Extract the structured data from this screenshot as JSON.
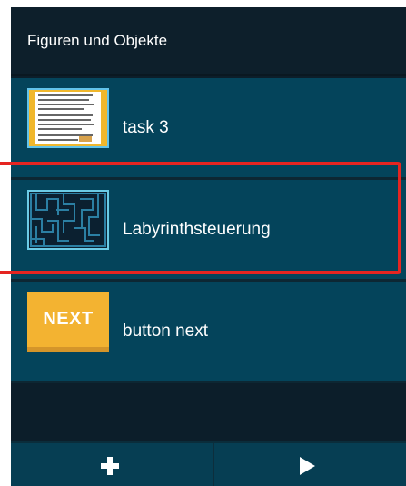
{
  "header": {
    "title": "Figuren und Objekte"
  },
  "items": [
    {
      "label": "task 3",
      "thumb": "document-thumbnail"
    },
    {
      "label": "Labyrinthsteuerung",
      "thumb": "maze-thumbnail",
      "selected": true
    },
    {
      "label": "button next",
      "thumb": "next-button-thumbnail",
      "thumb_text": "NEXT"
    }
  ],
  "bottom_bar": {
    "add_icon": "plus-icon",
    "play_icon": "play-icon"
  },
  "colors": {
    "header_bg": "#0d1f2b",
    "item_bg": "#04445b",
    "selection_border": "#e52521",
    "next_thumb": "#f3b331"
  }
}
